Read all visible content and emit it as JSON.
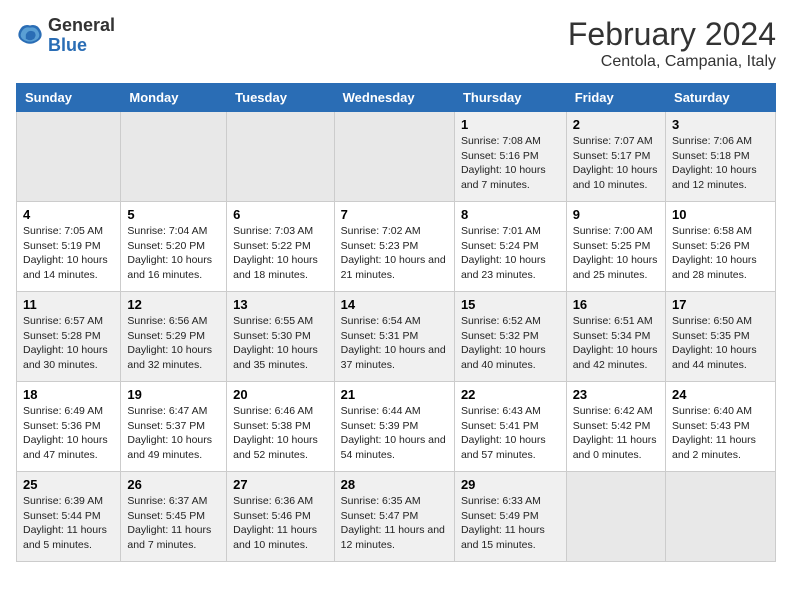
{
  "header": {
    "logo_line1": "General",
    "logo_line2": "Blue",
    "title": "February 2024",
    "subtitle": "Centola, Campania, Italy"
  },
  "weekdays": [
    "Sunday",
    "Monday",
    "Tuesday",
    "Wednesday",
    "Thursday",
    "Friday",
    "Saturday"
  ],
  "weeks": [
    [
      {
        "day": "",
        "empty": true
      },
      {
        "day": "",
        "empty": true
      },
      {
        "day": "",
        "empty": true
      },
      {
        "day": "",
        "empty": true
      },
      {
        "day": "1",
        "sunrise": "7:08 AM",
        "sunset": "5:16 PM",
        "daylight": "10 hours and 7 minutes."
      },
      {
        "day": "2",
        "sunrise": "7:07 AM",
        "sunset": "5:17 PM",
        "daylight": "10 hours and 10 minutes."
      },
      {
        "day": "3",
        "sunrise": "7:06 AM",
        "sunset": "5:18 PM",
        "daylight": "10 hours and 12 minutes."
      }
    ],
    [
      {
        "day": "4",
        "sunrise": "7:05 AM",
        "sunset": "5:19 PM",
        "daylight": "10 hours and 14 minutes."
      },
      {
        "day": "5",
        "sunrise": "7:04 AM",
        "sunset": "5:20 PM",
        "daylight": "10 hours and 16 minutes."
      },
      {
        "day": "6",
        "sunrise": "7:03 AM",
        "sunset": "5:22 PM",
        "daylight": "10 hours and 18 minutes."
      },
      {
        "day": "7",
        "sunrise": "7:02 AM",
        "sunset": "5:23 PM",
        "daylight": "10 hours and 21 minutes."
      },
      {
        "day": "8",
        "sunrise": "7:01 AM",
        "sunset": "5:24 PM",
        "daylight": "10 hours and 23 minutes."
      },
      {
        "day": "9",
        "sunrise": "7:00 AM",
        "sunset": "5:25 PM",
        "daylight": "10 hours and 25 minutes."
      },
      {
        "day": "10",
        "sunrise": "6:58 AM",
        "sunset": "5:26 PM",
        "daylight": "10 hours and 28 minutes."
      }
    ],
    [
      {
        "day": "11",
        "sunrise": "6:57 AM",
        "sunset": "5:28 PM",
        "daylight": "10 hours and 30 minutes."
      },
      {
        "day": "12",
        "sunrise": "6:56 AM",
        "sunset": "5:29 PM",
        "daylight": "10 hours and 32 minutes."
      },
      {
        "day": "13",
        "sunrise": "6:55 AM",
        "sunset": "5:30 PM",
        "daylight": "10 hours and 35 minutes."
      },
      {
        "day": "14",
        "sunrise": "6:54 AM",
        "sunset": "5:31 PM",
        "daylight": "10 hours and 37 minutes."
      },
      {
        "day": "15",
        "sunrise": "6:52 AM",
        "sunset": "5:32 PM",
        "daylight": "10 hours and 40 minutes."
      },
      {
        "day": "16",
        "sunrise": "6:51 AM",
        "sunset": "5:34 PM",
        "daylight": "10 hours and 42 minutes."
      },
      {
        "day": "17",
        "sunrise": "6:50 AM",
        "sunset": "5:35 PM",
        "daylight": "10 hours and 44 minutes."
      }
    ],
    [
      {
        "day": "18",
        "sunrise": "6:49 AM",
        "sunset": "5:36 PM",
        "daylight": "10 hours and 47 minutes."
      },
      {
        "day": "19",
        "sunrise": "6:47 AM",
        "sunset": "5:37 PM",
        "daylight": "10 hours and 49 minutes."
      },
      {
        "day": "20",
        "sunrise": "6:46 AM",
        "sunset": "5:38 PM",
        "daylight": "10 hours and 52 minutes."
      },
      {
        "day": "21",
        "sunrise": "6:44 AM",
        "sunset": "5:39 PM",
        "daylight": "10 hours and 54 minutes."
      },
      {
        "day": "22",
        "sunrise": "6:43 AM",
        "sunset": "5:41 PM",
        "daylight": "10 hours and 57 minutes."
      },
      {
        "day": "23",
        "sunrise": "6:42 AM",
        "sunset": "5:42 PM",
        "daylight": "11 hours and 0 minutes."
      },
      {
        "day": "24",
        "sunrise": "6:40 AM",
        "sunset": "5:43 PM",
        "daylight": "11 hours and 2 minutes."
      }
    ],
    [
      {
        "day": "25",
        "sunrise": "6:39 AM",
        "sunset": "5:44 PM",
        "daylight": "11 hours and 5 minutes."
      },
      {
        "day": "26",
        "sunrise": "6:37 AM",
        "sunset": "5:45 PM",
        "daylight": "11 hours and 7 minutes."
      },
      {
        "day": "27",
        "sunrise": "6:36 AM",
        "sunset": "5:46 PM",
        "daylight": "11 hours and 10 minutes."
      },
      {
        "day": "28",
        "sunrise": "6:35 AM",
        "sunset": "5:47 PM",
        "daylight": "11 hours and 12 minutes."
      },
      {
        "day": "29",
        "sunrise": "6:33 AM",
        "sunset": "5:49 PM",
        "daylight": "11 hours and 15 minutes."
      },
      {
        "day": "",
        "empty": true
      },
      {
        "day": "",
        "empty": true
      }
    ]
  ],
  "labels": {
    "sunrise": "Sunrise:",
    "sunset": "Sunset:",
    "daylight": "Daylight:"
  }
}
